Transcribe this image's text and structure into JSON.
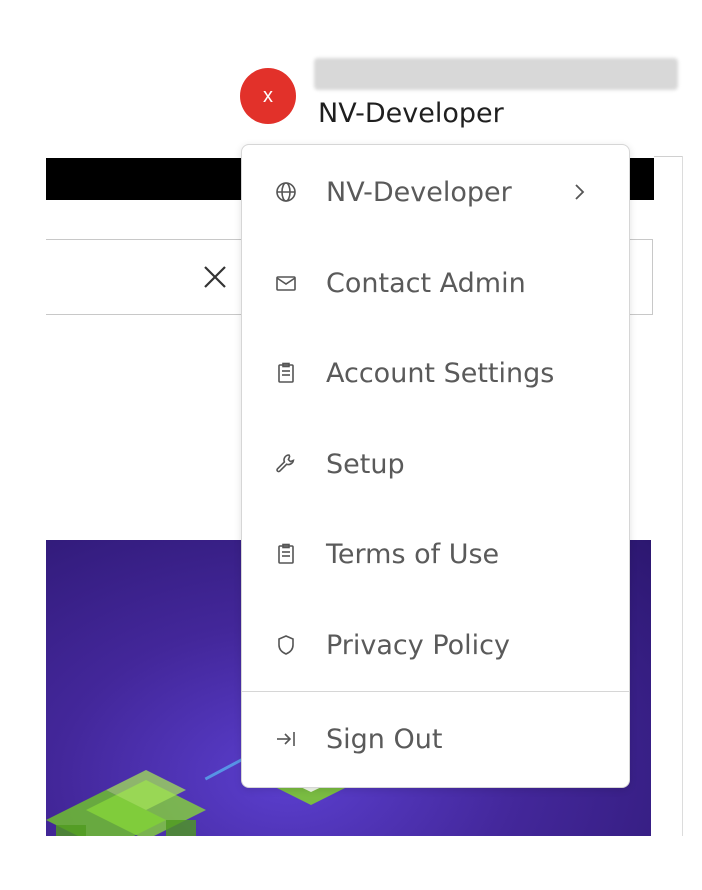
{
  "header": {
    "avatar_initial": "x",
    "account_name": "NV-Developer",
    "avatar_color": "#e2312a"
  },
  "search": {
    "clear_icon": "close-icon"
  },
  "menu": {
    "items": [
      {
        "label": "NV-Developer",
        "icon": "globe-icon",
        "has_submenu": true
      },
      {
        "label": "Contact Admin",
        "icon": "mail-icon"
      },
      {
        "label": "Account Settings",
        "icon": "clipboard-icon"
      },
      {
        "label": "Setup",
        "icon": "wrench-icon"
      },
      {
        "label": "Terms of Use",
        "icon": "clipboard-icon"
      },
      {
        "label": "Privacy Policy",
        "icon": "shield-icon"
      },
      {
        "label": "Sign Out",
        "icon": "sign-out-icon"
      }
    ]
  }
}
